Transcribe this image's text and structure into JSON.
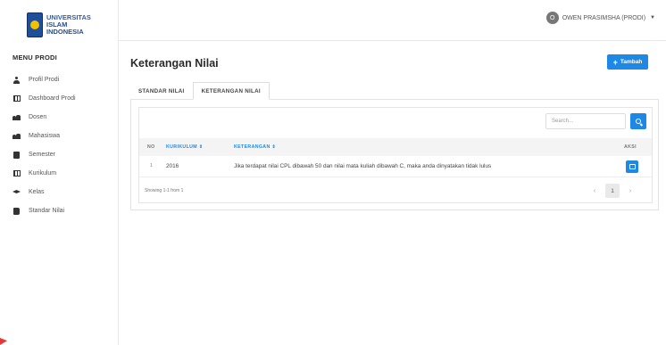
{
  "brand": {
    "line1": "UNIVERSITAS",
    "line2": "ISLAM",
    "line3": "INDONESIA"
  },
  "sidebar": {
    "title": "MENU PRODI",
    "items": [
      {
        "label": "Profil Prodi",
        "icon": "user-icon"
      },
      {
        "label": "Dashboard Prodi",
        "icon": "table-icon"
      },
      {
        "label": "Dosen",
        "icon": "users-icon"
      },
      {
        "label": "Mahasiswa",
        "icon": "users-icon"
      },
      {
        "label": "Semester",
        "icon": "square-icon"
      },
      {
        "label": "Kurikulum",
        "icon": "table-icon"
      },
      {
        "label": "Kelas",
        "icon": "graduation-cap-icon"
      },
      {
        "label": "Standar Nilai",
        "icon": "book-icon"
      }
    ]
  },
  "header": {
    "avatar_initial": "O",
    "user_name": "OWEN PRASIMSHA (PRODI)",
    "caret": "▼"
  },
  "page": {
    "title": "Keterangan Nilai",
    "add_button": "Tambah",
    "add_plus": "+"
  },
  "tabs": [
    {
      "label": "STANDAR NILAI"
    },
    {
      "label": "KETERANGAN NILAI"
    }
  ],
  "table": {
    "search_placeholder": "Search...",
    "headers": {
      "no": "NO",
      "kurikulum": "KURIKULUM ⇕",
      "keterangan": "KETERANGAN ⇕",
      "aksi": "AKSI"
    },
    "rows": [
      {
        "no": "1",
        "kurikulum": "2016",
        "keterangan": "Jika terdapat nilai CPL dibawah 50 dan nilai mata kuliah dibawah C, maka anda dinyatakan tidak lulus"
      }
    ],
    "footer": {
      "showing": "Showing 1-1 from 1",
      "prev": "‹",
      "page": "1",
      "next": "›"
    }
  },
  "colors": {
    "accent": "#1e88e5",
    "brand": "#1f4f99",
    "logo_gold": "#f2c200"
  }
}
